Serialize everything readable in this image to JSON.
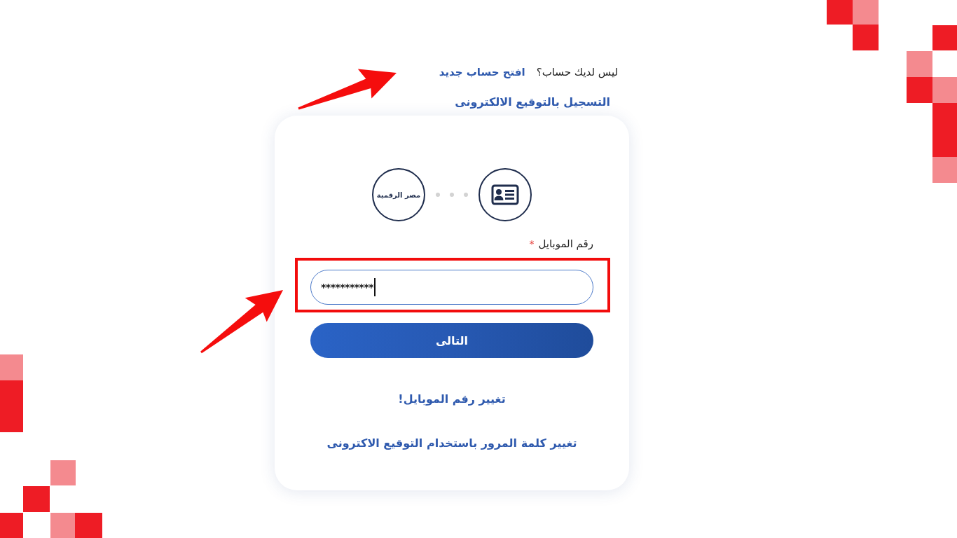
{
  "signup_prompt": {
    "text": "ليس لديك حساب؟",
    "link": "افتح حساب جديد"
  },
  "esign_link": "التسجيل بالتوقيع الالكترونى",
  "login_card": {
    "steps": [
      {
        "kind": "id-card"
      },
      {
        "kind": "brand",
        "label": "مصر الرقمية"
      }
    ],
    "phone_field": {
      "label": "رقم الموبايل",
      "required_mark": "*",
      "value": "***********",
      "focused": true,
      "highlighted": true
    },
    "next_button": "التالى",
    "links": [
      "تغيير رقم الموبايل!",
      "تغيير كلمة المرور باستخدام التوقيع الاكترونى"
    ]
  }
}
